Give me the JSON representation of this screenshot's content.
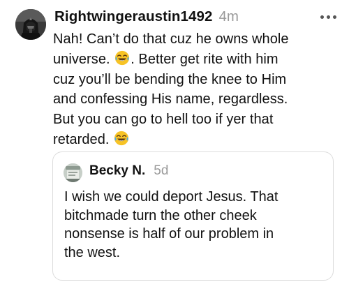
{
  "post": {
    "username": "Rightwingeraustin1492",
    "timestamp": "4m",
    "body_lines": [
      [
        "Nah! Can’t do that cuz he owns whole",
        "",
        ""
      ],
      [
        "universe. ",
        "😂",
        ".  Better get rite with him"
      ],
      [
        "cuz you’ll be bending the knee to Him",
        "",
        ""
      ],
      [
        "and confessing His name, regardless.",
        "",
        ""
      ],
      [
        "But you can go to hell too if yer that",
        "",
        ""
      ],
      [
        "retarded. ",
        "😂",
        ""
      ]
    ],
    "more_icon": "ellipsis-icon",
    "avatar_icon": "profile-avatar"
  },
  "quoted": {
    "username": "Becky N.",
    "timestamp": "5d",
    "text_lines": [
      "I wish we could deport Jesus. That",
      "bitchmade turn the other cheek",
      "nonsense is half of our problem in",
      "the west."
    ],
    "avatar_icon": "profile-avatar"
  },
  "colors": {
    "text": "#111111",
    "muted": "#9a9a9a",
    "border": "#dcdcdc",
    "emoji_face": "#f7c325"
  }
}
